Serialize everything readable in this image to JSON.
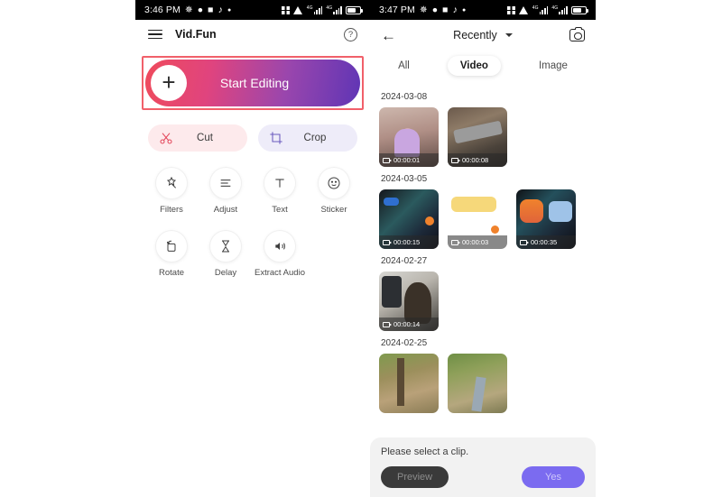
{
  "left_phone": {
    "status_bar": {
      "time": "3:46 PM",
      "icons": [
        "bluetooth-icon",
        "message-icon",
        "app-icon",
        "tiktok-icon",
        "dot-icon"
      ],
      "right_icons": [
        "sim-icon",
        "wifi-icon",
        "signal-icon",
        "signal-icon",
        "battery-icon"
      ]
    },
    "app_bar": {
      "menu_icon": "hamburger-icon",
      "title": "Vid.Fun",
      "help_label": "?"
    },
    "start_editing": {
      "label": "Start Editing",
      "plus_icon": "plus-icon",
      "highlight_color": "#f1606a",
      "gradient_start": "#ef4b5c",
      "gradient_end": "#5f35b5"
    },
    "quick_actions": [
      {
        "label": "Cut",
        "icon": "scissors-icon",
        "bg": "#fdeaec"
      },
      {
        "label": "Crop",
        "icon": "crop-icon",
        "bg": "#eeecf9"
      }
    ],
    "tools_row1": [
      {
        "label": "Filters",
        "icon": "magic-wand-icon"
      },
      {
        "label": "Adjust",
        "icon": "sliders-icon"
      },
      {
        "label": "Text",
        "icon": "text-icon"
      },
      {
        "label": "Sticker",
        "icon": "smiley-icon"
      }
    ],
    "tools_row2": [
      {
        "label": "Rotate",
        "icon": "rotate-icon"
      },
      {
        "label": "Delay",
        "icon": "hourglass-icon"
      },
      {
        "label": "Extract Audio",
        "icon": "speaker-icon"
      }
    ]
  },
  "right_phone": {
    "status_bar": {
      "time": "3:47 PM",
      "icons": [
        "bluetooth-icon",
        "message-icon",
        "app-icon",
        "tiktok-icon",
        "dot-icon"
      ],
      "right_icons": [
        "sim-icon",
        "wifi-icon",
        "signal-icon",
        "signal-icon",
        "battery-icon"
      ]
    },
    "nav": {
      "back_icon": "back-arrow-icon",
      "title": "Recently",
      "dropdown_icon": "chevron-down-icon",
      "camera_icon": "camera-icon"
    },
    "tabs": [
      {
        "label": "All",
        "active": false
      },
      {
        "label": "Video",
        "active": true
      },
      {
        "label": "Image",
        "active": false
      }
    ],
    "gallery": [
      {
        "date": "2024-03-08",
        "items": [
          {
            "duration": "00:00:01",
            "art": "tb1",
            "type": "video"
          },
          {
            "duration": "00:00:08",
            "art": "tb2",
            "type": "video"
          }
        ]
      },
      {
        "date": "2024-03-05",
        "items": [
          {
            "duration": "00:00:15",
            "art": "tb3",
            "type": "video"
          },
          {
            "duration": "00:00:03",
            "art": "tb4",
            "type": "video"
          },
          {
            "duration": "00:00:35",
            "art": "tb5",
            "type": "video"
          }
        ]
      },
      {
        "date": "2024-02-27",
        "items": [
          {
            "duration": "00:00:14",
            "art": "tb6",
            "type": "video"
          }
        ]
      },
      {
        "date": "2024-02-25",
        "items": [
          {
            "duration": "",
            "art": "tb7",
            "type": "video"
          },
          {
            "duration": "",
            "art": "tb8",
            "type": "video"
          }
        ]
      }
    ],
    "bottom_sheet": {
      "message": "Please select a clip.",
      "preview_label": "Preview",
      "confirm_label": "Yes",
      "confirm_color": "#7b6bf0"
    }
  }
}
